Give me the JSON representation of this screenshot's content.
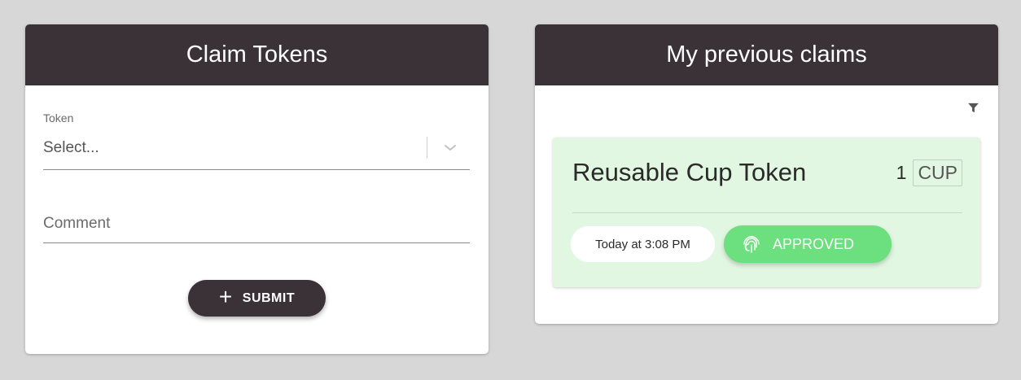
{
  "claim_form": {
    "title": "Claim Tokens",
    "token_label": "Token",
    "token_select_placeholder": "Select...",
    "comment_placeholder": "Comment",
    "submit_label": "SUBMIT",
    "submit_icon": "plus-icon"
  },
  "previous_claims": {
    "title": "My previous claims",
    "filter_icon": "filter-icon",
    "items": [
      {
        "token_name": "Reusable Cup Token",
        "quantity": "1",
        "unit": "CUP",
        "time": "Today at 3:08 PM",
        "status": "APPROVED",
        "status_icon": "fingerprint-icon"
      }
    ]
  },
  "colors": {
    "background": "#d7d7d7",
    "header": "#3b3238",
    "approved_bg": "#e2f7e2",
    "approved_pill": "#6cdf7e"
  }
}
